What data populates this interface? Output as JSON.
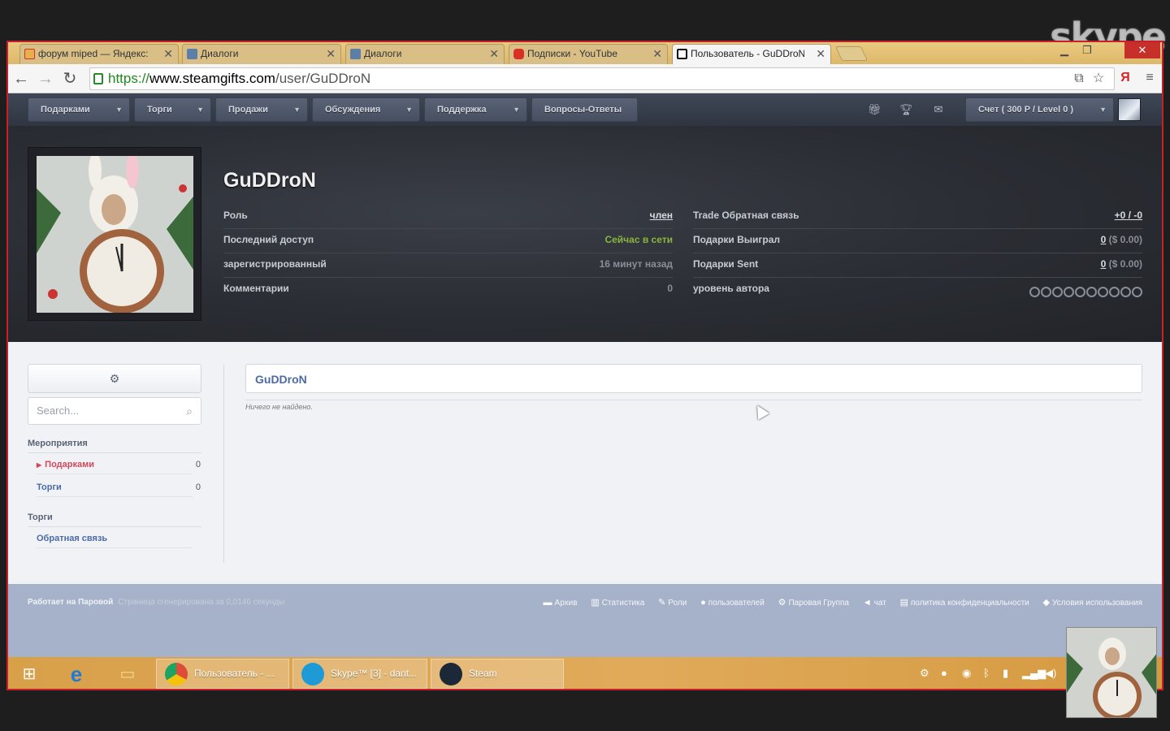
{
  "skype": {
    "logo_text": "skype"
  },
  "browser": {
    "tabs": [
      {
        "title": "форум miped — Яндекс:",
        "icon": "yandex-icon",
        "color": "#e8b04a"
      },
      {
        "title": "Диалоги",
        "icon": "vk-icon",
        "color": "#5b7fa6"
      },
      {
        "title": "Диалоги",
        "icon": "vk-icon",
        "color": "#5b7fa6"
      },
      {
        "title": "Подписки - YouTube",
        "icon": "youtube-icon",
        "color": "#d93025"
      },
      {
        "title": "Пользователь - GuDDroN",
        "icon": "steamgifts-icon",
        "color": "#111111",
        "active": true
      }
    ],
    "url": {
      "scheme": "https://",
      "host": "www.steamgifts.com",
      "path": "/user/GuDDroN"
    }
  },
  "sitenav": {
    "items": [
      "Подарками",
      "Торги",
      "Продажи",
      "Обсуждения",
      "Поддержка",
      "Вопросы-Ответы"
    ],
    "account": "Счет ( 300 P / Level 0 )"
  },
  "profile": {
    "name": "GuDDroN",
    "stats_left": [
      {
        "label": "Роль",
        "value": "член"
      },
      {
        "label": "Последний доступ",
        "value": "Сейчас в сети"
      },
      {
        "label": "зарегистрированный",
        "value": "16 минут назад"
      },
      {
        "label": "Комментарии",
        "value": "0"
      }
    ],
    "stats_right": [
      {
        "label": "Trade Обратная связь",
        "value": "+0 / -0"
      },
      {
        "label": "Подарки Выиграл",
        "num": "0",
        "value": "($ 0.00)"
      },
      {
        "label": "Подарки Sent",
        "num": "0",
        "value": "($ 0.00)"
      },
      {
        "label": "уровень автора",
        "value": ""
      }
    ]
  },
  "sidebar": {
    "search_placeholder": "Search...",
    "section1": "Мероприятия",
    "items1": [
      {
        "label": "Подарками",
        "count": "0"
      },
      {
        "label": "Торги",
        "count": "0"
      }
    ],
    "section2": "Торги",
    "items2": [
      {
        "label": "Обратная связь"
      }
    ]
  },
  "content": {
    "title": "GuDDroN",
    "empty": "Ничего не найдено."
  },
  "footer": {
    "powered": "Работает на Паровой",
    "generated": "Страница сгенерирована за 0,0146 секунды",
    "links": [
      "Архив",
      "Статистика",
      "Роли",
      "пользователей",
      "Паровая Группа",
      "чат",
      "политика конфиденциальности",
      "Условия использования"
    ]
  },
  "taskbar": {
    "tasks": [
      {
        "label": "Пользователь - ...",
        "color": "#dd4b39"
      },
      {
        "label": "Skype™ [3] - dant...",
        "color": "#1e9bd7"
      },
      {
        "label": "Steam",
        "color": "#1b2838"
      }
    ]
  },
  "colors": {
    "accent_link": "#4b6aa8",
    "online_green": "#8ab53c",
    "active_red": "#d2485a"
  }
}
